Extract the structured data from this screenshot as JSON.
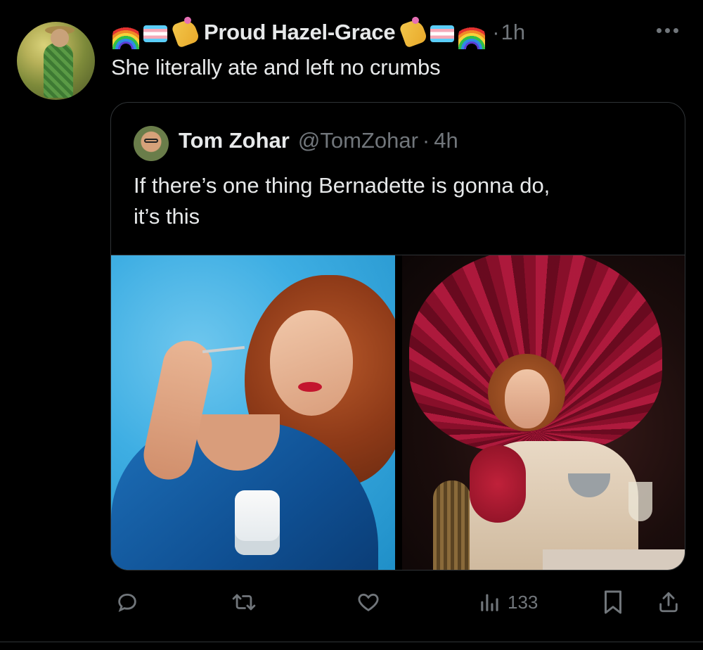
{
  "tweet": {
    "display_name": "Proud Hazel-Grace",
    "separator": "·",
    "time": "1h",
    "text": "She literally ate and left no crumbs",
    "name_emojis_left": [
      "rainbow-icon",
      "trans-flag-icon",
      "nail-polish-icon"
    ],
    "name_emojis_right": [
      "nail-polish-icon",
      "trans-flag-icon",
      "rainbow-icon"
    ]
  },
  "quote": {
    "name": "Tom Zohar",
    "handle": "@TomZohar",
    "separator": "·",
    "time": "4h",
    "text_line1": "If there’s one thing Bernadette is gonna do,",
    "text_line2": "it’s this"
  },
  "actions": {
    "reply": "reply-icon",
    "retweet": "retweet-icon",
    "like": "heart-icon",
    "views_count": "133",
    "bookmark": "bookmark-icon",
    "share": "share-icon"
  },
  "colors": {
    "background": "#000000",
    "text": "#e7e9ea",
    "muted": "#71767b",
    "border": "#2f3336"
  }
}
